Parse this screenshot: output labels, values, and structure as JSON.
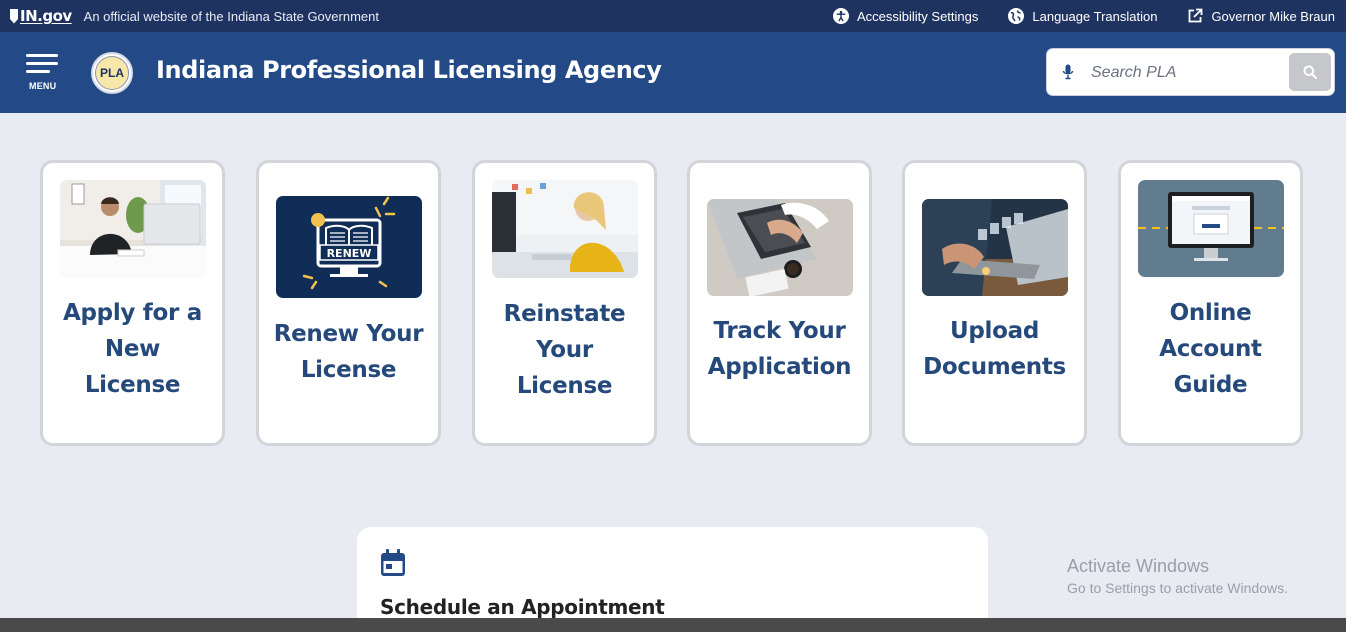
{
  "topbar": {
    "brand": "IN.gov",
    "official": "An official website of the Indiana State Government",
    "links": [
      {
        "label": "Accessibility Settings",
        "icon": "accessibility-icon"
      },
      {
        "label": "Language Translation",
        "icon": "globe-icon"
      },
      {
        "label": "Governor Mike Braun",
        "icon": "external-link-icon"
      }
    ]
  },
  "header": {
    "menu_label": "MENU",
    "logo_text": "PLA",
    "title": "Indiana Professional Licensing Agency",
    "search_placeholder": "Search PLA"
  },
  "cards": [
    {
      "label_lines": [
        "Apply for a",
        "New",
        "License"
      ],
      "image": "person-at-desk-photo"
    },
    {
      "label_lines": [
        "Renew Your",
        "License"
      ],
      "image": "renew-illustration",
      "image_text": "RENEW"
    },
    {
      "label_lines": [
        "Reinstate",
        "Your",
        "License"
      ],
      "image": "woman-at-computer-photo"
    },
    {
      "label_lines": [
        "Track Your",
        "Application"
      ],
      "image": "typing-laptop-photo"
    },
    {
      "label_lines": [
        "Upload",
        "Documents"
      ],
      "image": "upload-documents-photo"
    },
    {
      "label_lines": [
        "Online",
        "Account",
        "Guide"
      ],
      "image": "monitor-screenshot-photo"
    }
  ],
  "appointment": {
    "title": "Schedule an Appointment",
    "icon": "calendar-icon"
  },
  "watermark": {
    "line1": "Activate Windows",
    "line2": "Go to Settings to activate Windows."
  },
  "colors": {
    "topbar": "#1f3361",
    "header": "#234a87",
    "page_bg": "#e9ebf2",
    "card_title": "#24497a"
  }
}
